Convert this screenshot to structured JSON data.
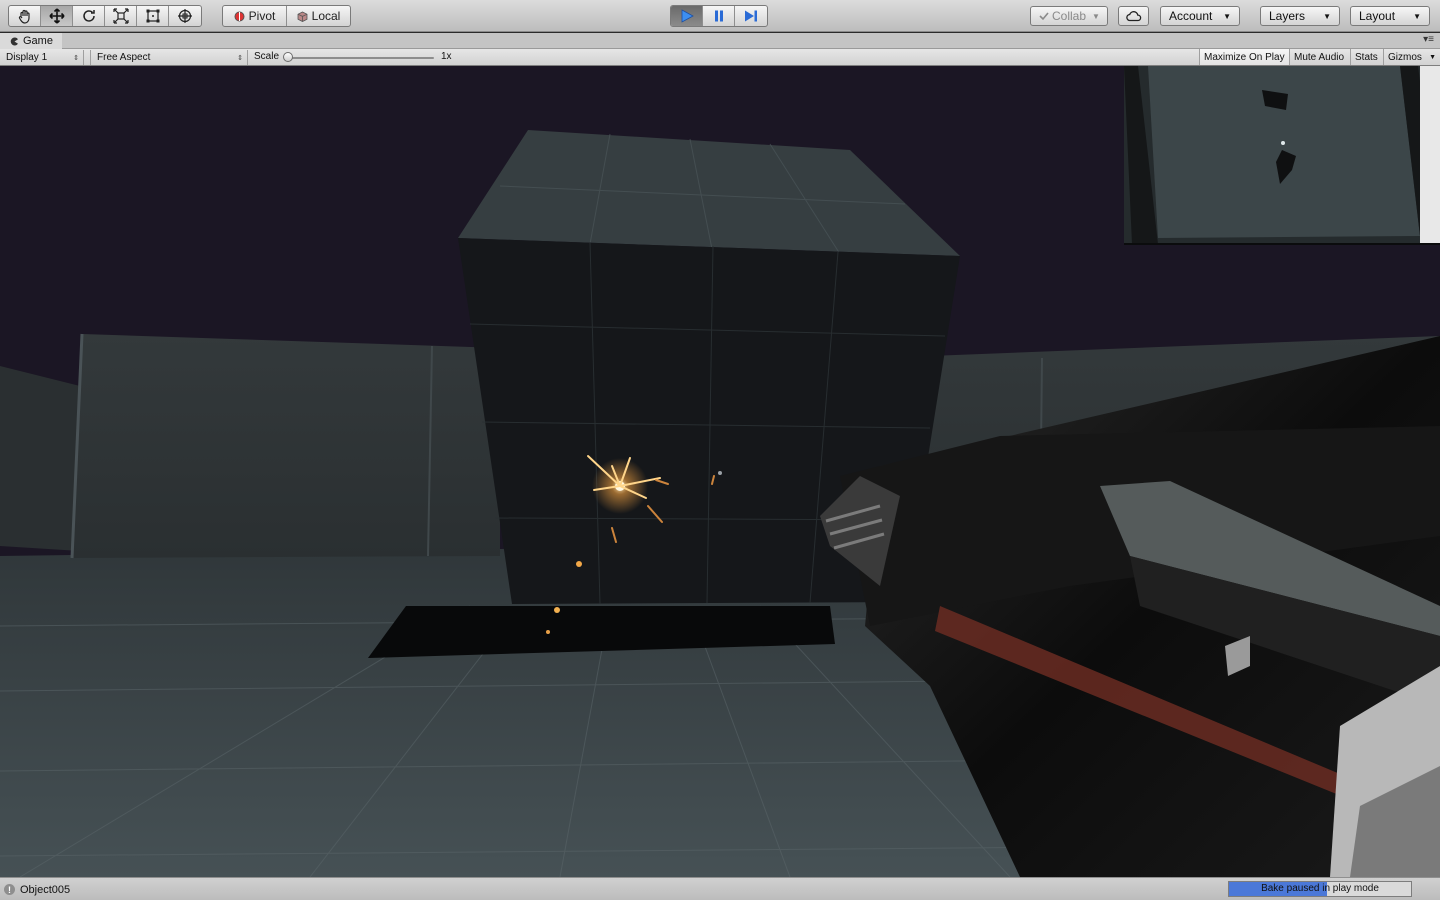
{
  "toolbar": {
    "tools": [
      "hand-tool",
      "move-tool",
      "rotate-tool",
      "scale-tool",
      "rect-tool",
      "transform-tool"
    ],
    "active_tool": "move-tool",
    "pivot_label": "Pivot",
    "local_label": "Local",
    "collab_label": "Collab",
    "account_label": "Account",
    "layers_label": "Layers",
    "layout_label": "Layout"
  },
  "game_tab": {
    "title": "Game",
    "display": "Display 1",
    "aspect": "Free Aspect",
    "scale_label": "Scale",
    "scale_value": "1x",
    "scale_fraction": 0.0,
    "maximize_label": "Maximize On Play",
    "mute_label": "Mute Audio",
    "stats_label": "Stats",
    "gizmos_label": "Gizmos"
  },
  "status": {
    "message": "Object005",
    "bake_text": "Bake paused in play mode",
    "bake_progress": 0.54
  },
  "colors": {
    "sky": "#1b1624",
    "floor": "#3a4346",
    "cube_side": "#15171a",
    "accent_play": "#2a6bd6",
    "bake_fill": "#4b78d8"
  }
}
